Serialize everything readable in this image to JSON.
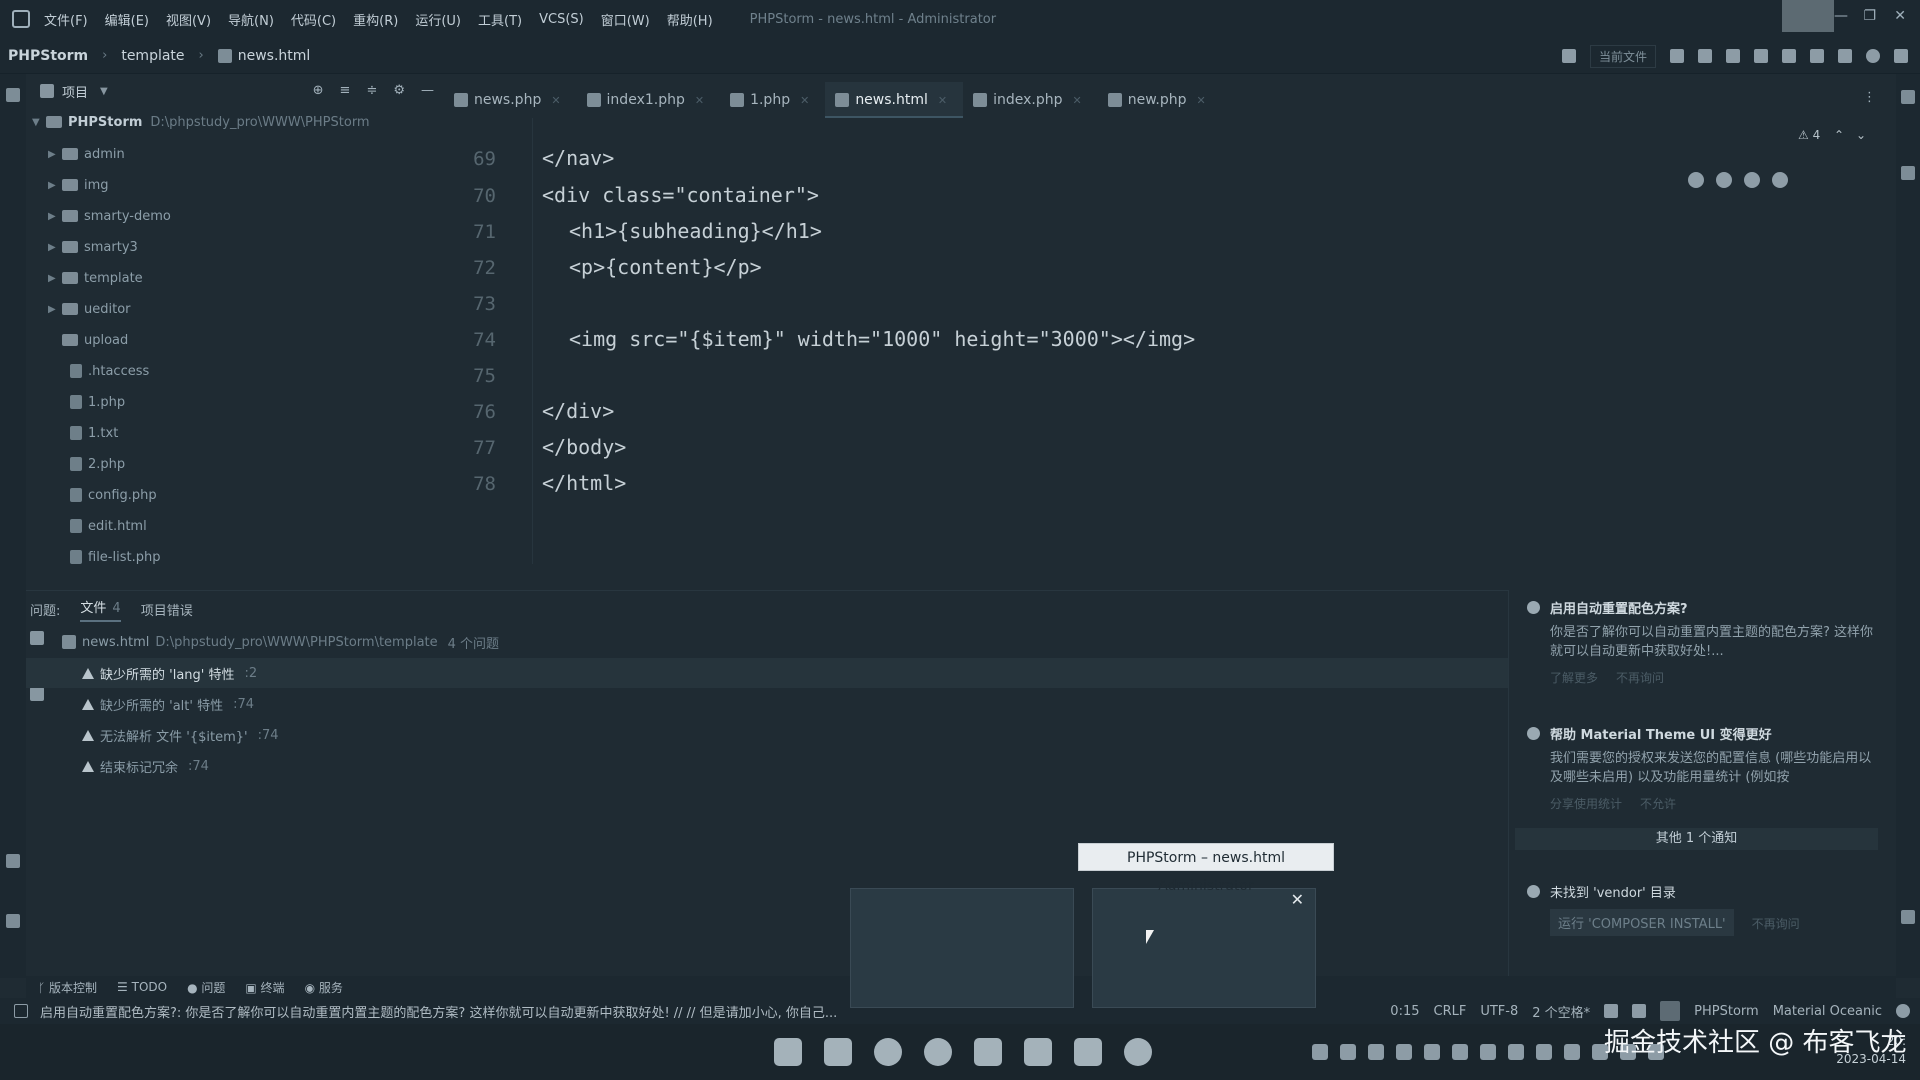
{
  "menubar": {
    "items": [
      "文件(F)",
      "编辑(E)",
      "视图(V)",
      "导航(N)",
      "代码(C)",
      "重构(R)",
      "运行(U)",
      "工具(T)",
      "VCS(S)",
      "窗口(W)",
      "帮助(H)"
    ],
    "window_title": "PHPStorm - news.html - Administrator"
  },
  "navbar": {
    "breadcrumb": [
      "PHPStorm",
      "template",
      "news.html"
    ],
    "run_config": "当前文件"
  },
  "project": {
    "header": "项目",
    "root": {
      "name": "PHPStorm",
      "path": "D:\\phpstudy_pro\\WWW\\PHPStorm"
    },
    "folders": [
      "admin",
      "img",
      "smarty-demo",
      "smarty3",
      "template",
      "ueditor",
      "upload"
    ],
    "files": [
      ".htaccess",
      "1.php",
      "1.txt",
      "2.php",
      "config.php",
      "edit.html",
      "file-list.php"
    ]
  },
  "tabs": [
    {
      "label": "news.php",
      "active": false
    },
    {
      "label": "index1.php",
      "active": false
    },
    {
      "label": "1.php",
      "active": false
    },
    {
      "label": "news.html",
      "active": true
    },
    {
      "label": "index.php",
      "active": false
    },
    {
      "label": "new.php",
      "active": false
    }
  ],
  "editor": {
    "warning_count": "4",
    "lines": [
      {
        "num": "69",
        "code": "</nav>"
      },
      {
        "num": "70",
        "code": "<div class=\"container\">"
      },
      {
        "num": "71",
        "code": "<h1>{subheading}</h1>"
      },
      {
        "num": "72",
        "code": "<p>{content}</p>"
      },
      {
        "num": "73",
        "code": ""
      },
      {
        "num": "74",
        "code": "<img src=\"{$item}\" width=\"1000\" height=\"3000\"></img>"
      },
      {
        "num": "75",
        "code": ""
      },
      {
        "num": "76",
        "code": "</div>"
      },
      {
        "num": "77",
        "code": "</body>"
      },
      {
        "num": "78",
        "code": "</html>"
      }
    ]
  },
  "problems": {
    "label": "问题:",
    "tabs": [
      {
        "label": "文件",
        "count": "4"
      },
      {
        "label": "项目错误"
      }
    ],
    "file_row": {
      "name": "news.html",
      "path": "D:\\phpstudy_pro\\WWW\\PHPStorm\\template",
      "summary": "4 个问题"
    },
    "items": [
      {
        "text": "缺少所需的 'lang' 特性",
        "loc": ":2"
      },
      {
        "text": "缺少所需的 'alt' 特性",
        "loc": ":74"
      },
      {
        "text": "无法解析 文件 '{$item}'",
        "loc": ":74"
      },
      {
        "text": "结束标记冗余",
        "loc": ":74"
      }
    ]
  },
  "notifications": [
    {
      "title": "启用自动重置配色方案?",
      "body": "你是否了解你可以自动重置内置主题的配色方案? 这样你就可以自动更新中获取好处!...",
      "actions": [
        "了解更多",
        "不再询问"
      ]
    },
    {
      "title": "帮助 Material Theme UI 变得更好",
      "body": "我们需要您的授权来发送您的配置信息 (哪些功能启用以及哪些未启用) 以及功能用量统计 (例如按",
      "actions": [
        "分享使用统计",
        "不允许"
      ]
    }
  ],
  "notif_others": "其他 1 个通知",
  "vendor_notif": {
    "title": "未找到 'vendor' 目录",
    "button": "运行 'COMPOSER INSTALL'",
    "secondary": "不再询问"
  },
  "toolbar": [
    "版本控制",
    "TODO",
    "问题",
    "终端",
    "服务"
  ],
  "status": {
    "message": "启用自动重置配色方案?: 你是否了解你可以自动重置内置主题的配色方案? 这样你就可以自动更新中获取好处! // // 但是请加小心, 你自己...",
    "items": [
      "0:15",
      "CRLF",
      "UTF-8",
      "2 个空格*",
      "PHPStorm",
      "Material Oceanic"
    ]
  },
  "tooltip": "PHPStorm – news.html Administrator",
  "clock": {
    "time": "20:",
    "date": "2023-04-14"
  },
  "watermark": "掘金技术社区 @ 布客飞龙"
}
